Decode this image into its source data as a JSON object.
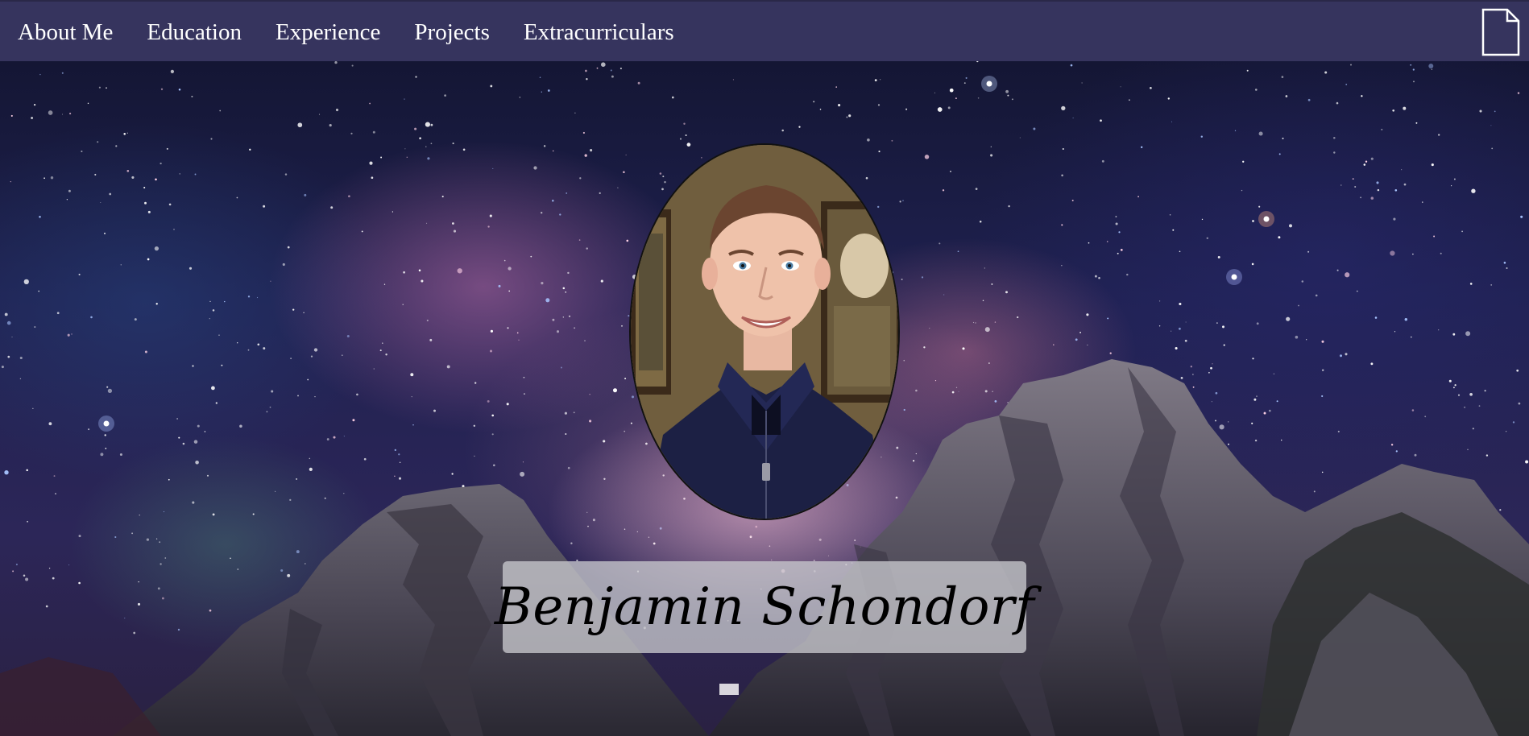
{
  "nav": {
    "links": [
      {
        "label": "About Me"
      },
      {
        "label": "Education"
      },
      {
        "label": "Experience"
      },
      {
        "label": "Projects"
      },
      {
        "label": "Extracurriculars"
      }
    ],
    "resume_icon": "document-icon"
  },
  "hero": {
    "background": "starry-night-mountains",
    "portrait_alt": "profile-photo",
    "name": "Benjamin Schondorf"
  },
  "colors": {
    "navbar": "#36345e",
    "nav_text": "#ffffff",
    "name_plate": "rgba(200,200,205,0.78)"
  }
}
